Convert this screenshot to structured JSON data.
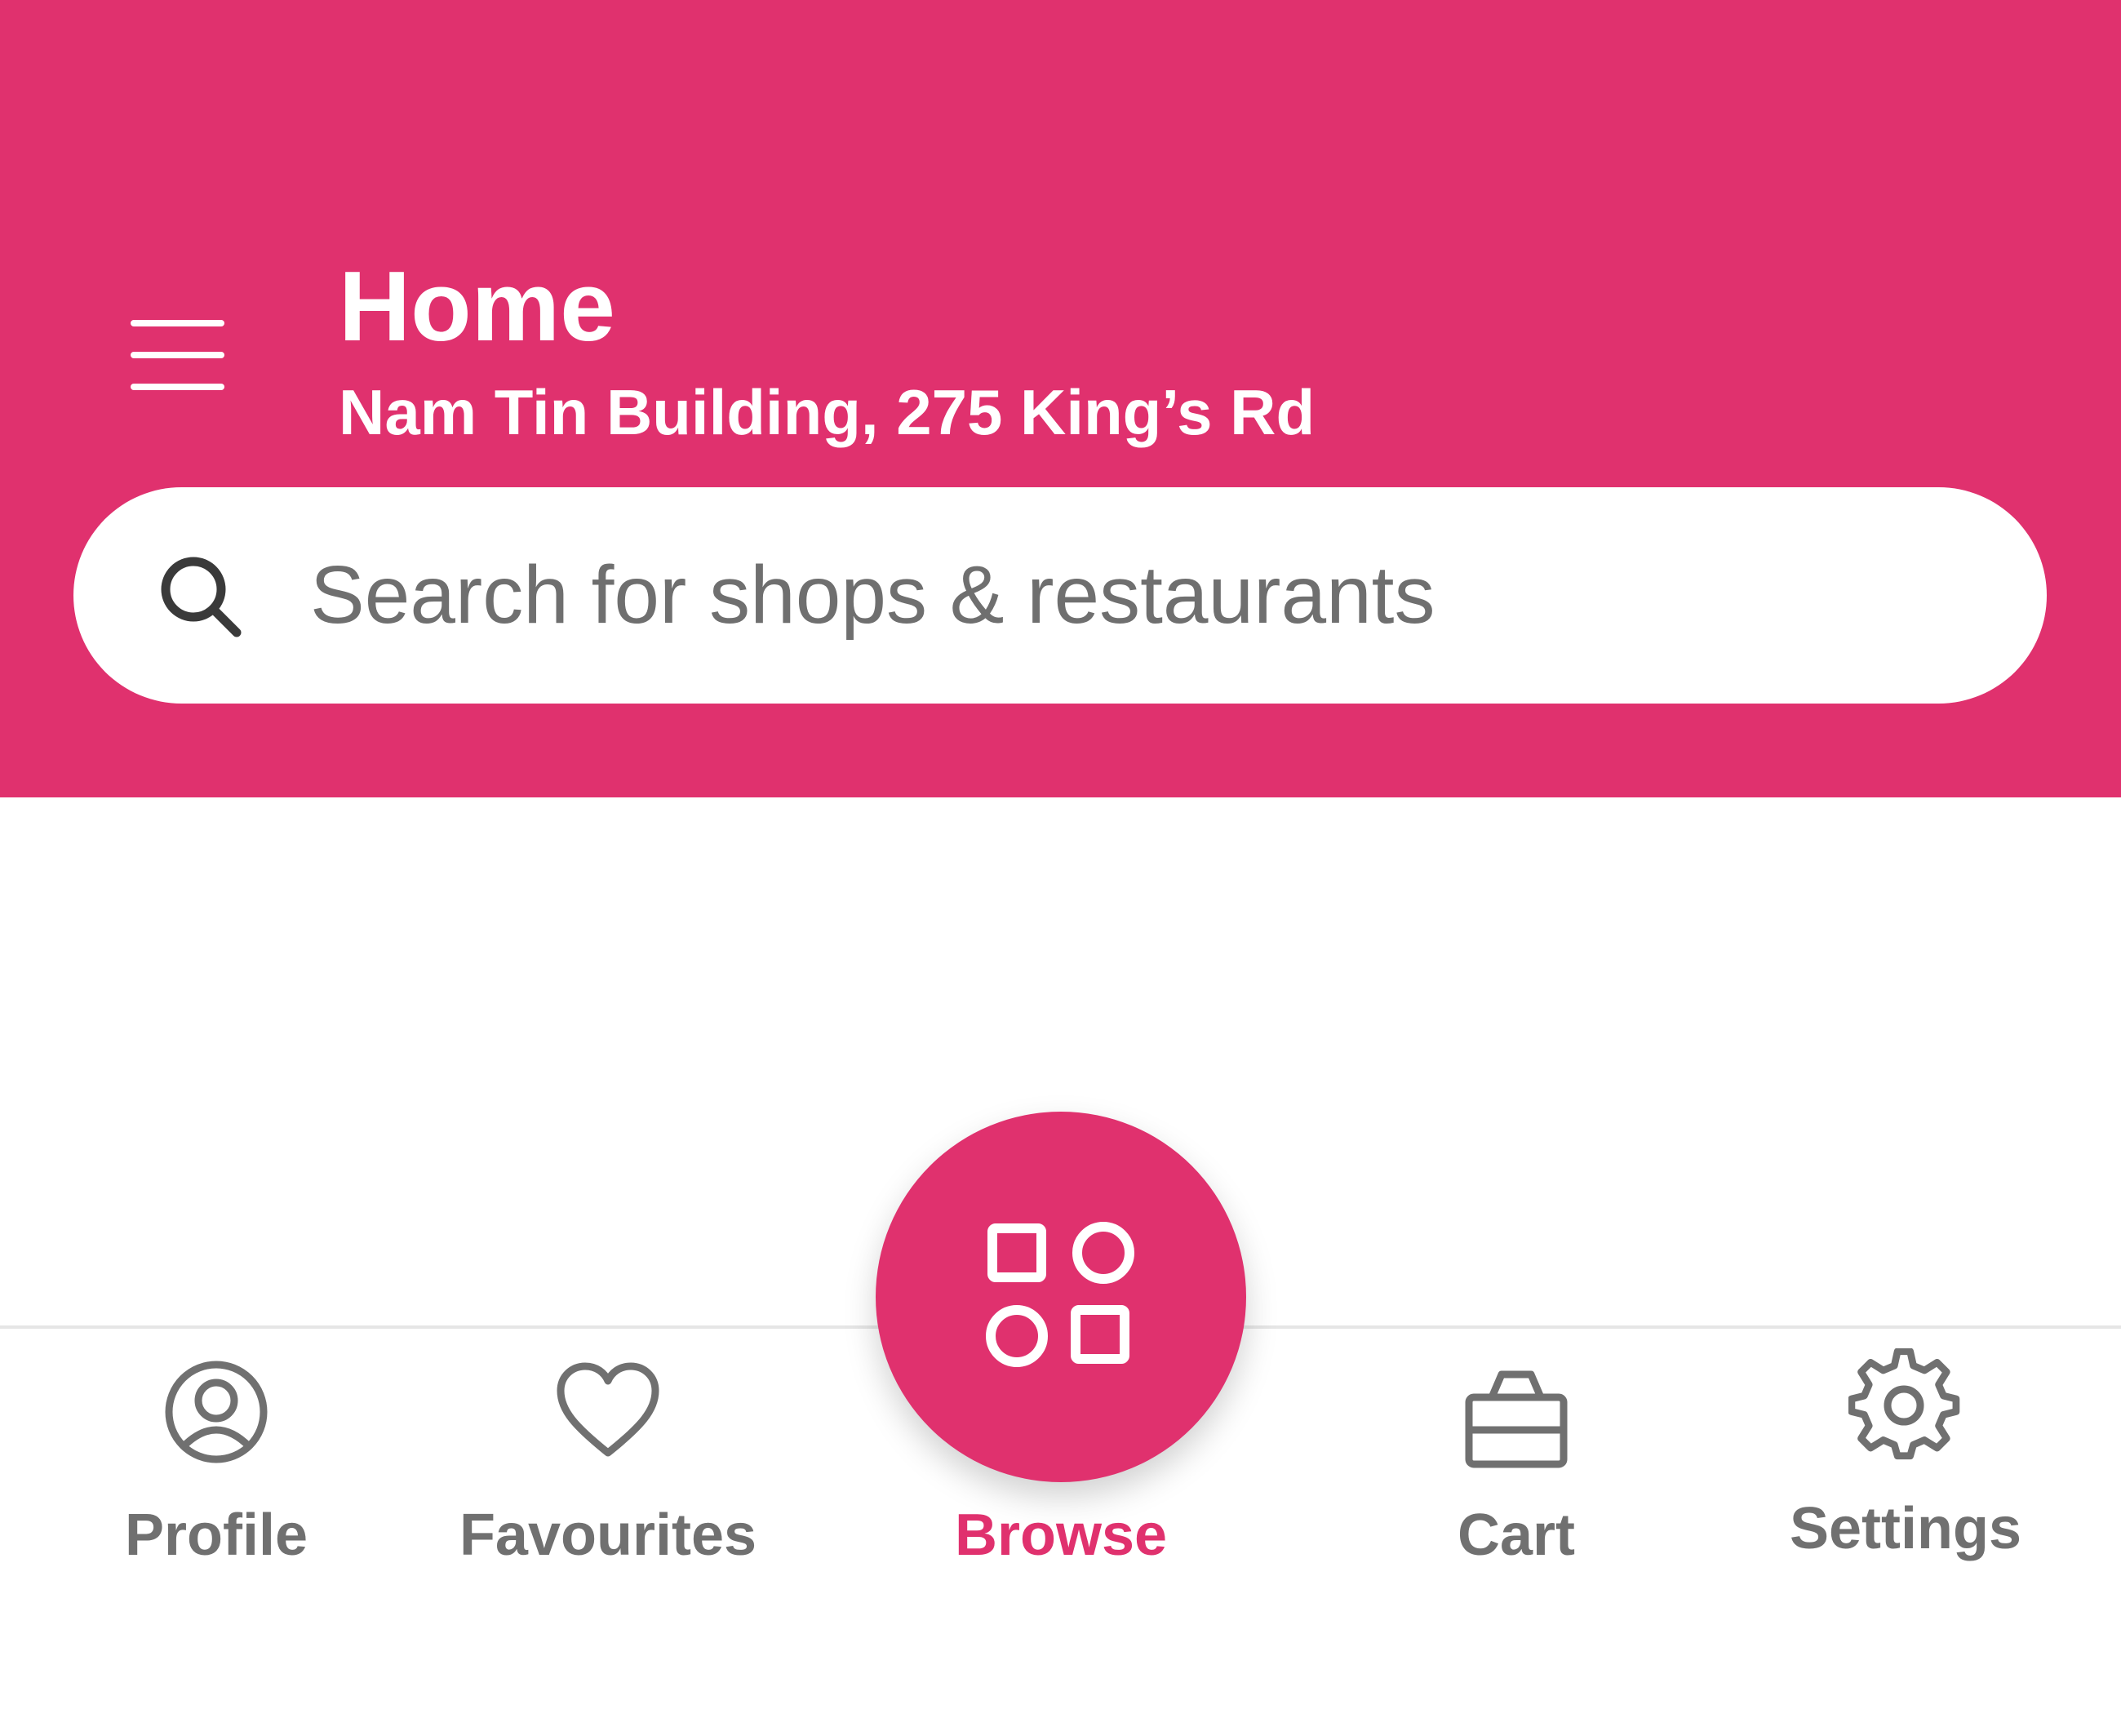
{
  "header": {
    "title": "Home",
    "subtitle": "Nam Tin Building, 275 King’s Rd",
    "menu_icon": "hamburger-menu-icon",
    "background_color": "#e0316e"
  },
  "search": {
    "placeholder": "Search for shops & restaurants",
    "value": "",
    "icon": "search-icon"
  },
  "bottom_nav": {
    "items": [
      {
        "label": "Profile",
        "icon": "profile-icon",
        "active": false
      },
      {
        "label": "Favourites",
        "icon": "heart-icon",
        "active": false
      },
      {
        "label": "Browse",
        "icon": "browse-grid-icon",
        "active": true
      },
      {
        "label": "Cart",
        "icon": "cart-basket-icon",
        "active": false
      },
      {
        "label": "Settings",
        "icon": "gear-icon",
        "active": false
      }
    ],
    "active_color": "#e0316e",
    "inactive_color": "#707070"
  }
}
